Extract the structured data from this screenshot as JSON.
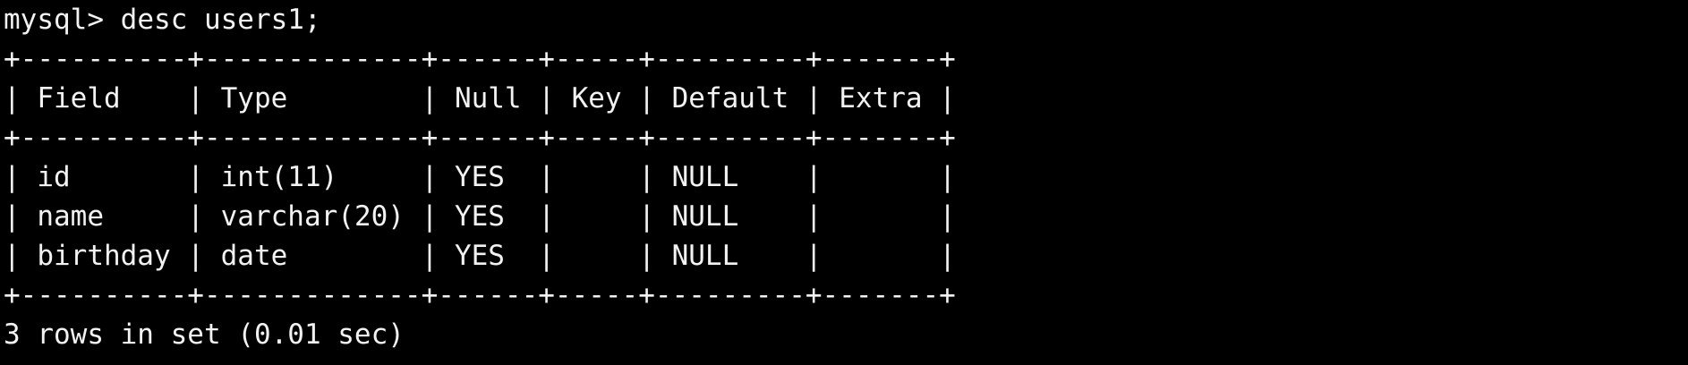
{
  "terminal": {
    "prompt": "mysql> ",
    "command": "desc users1;",
    "table_border": "+----------+-------------+------+-----+---------+-------+",
    "columns": [
      "Field",
      "Type",
      "Null",
      "Key",
      "Default",
      "Extra"
    ],
    "rows": [
      [
        "id",
        "int(11)",
        "YES",
        "",
        "NULL",
        ""
      ],
      [
        "name",
        "varchar(20)",
        "YES",
        "",
        "NULL",
        ""
      ],
      [
        "birthday",
        "date",
        "YES",
        "",
        "NULL",
        ""
      ]
    ],
    "summary": "3 rows in set (0.01 sec)"
  },
  "colors": {
    "background": "#000000",
    "text": "#f2f2f2"
  }
}
